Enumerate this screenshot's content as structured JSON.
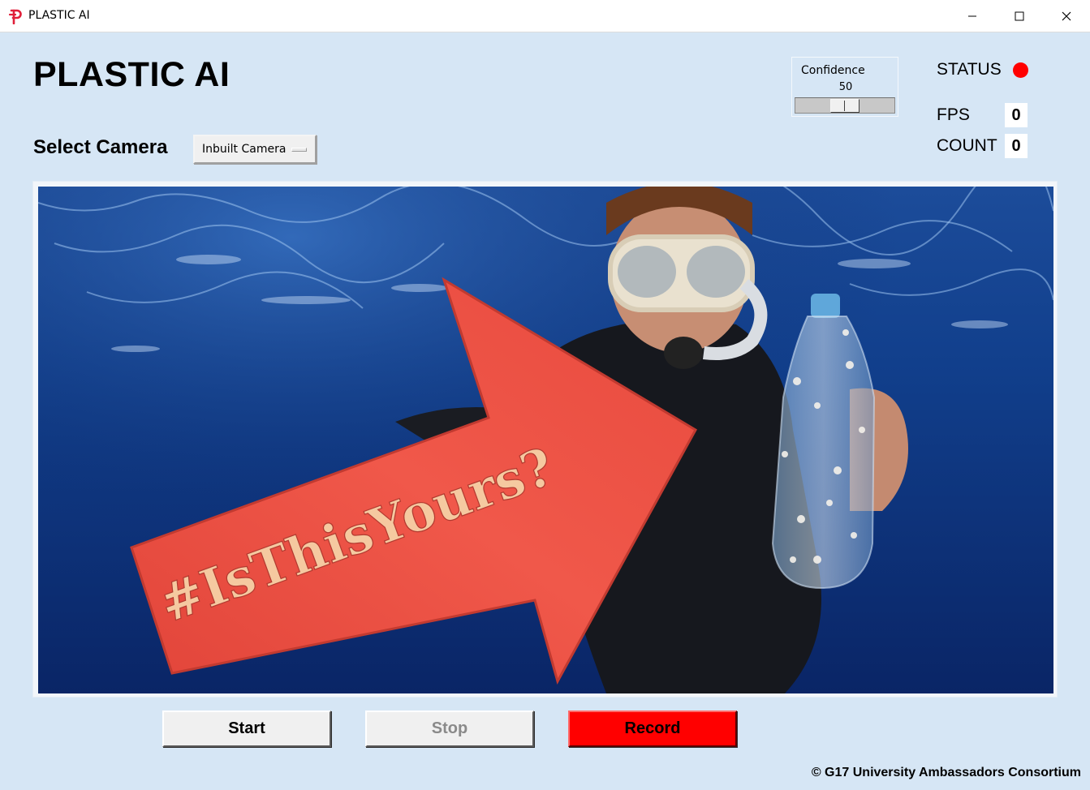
{
  "window": {
    "title": "PLASTIC AI",
    "icon": "plastic-ai-logo-icon",
    "controls": [
      "minimize-icon",
      "maximize-icon",
      "close-icon"
    ]
  },
  "header": {
    "app_title": "PLASTIC AI",
    "select_camera_label": "Select Camera",
    "camera_selected": "Inbuilt Camera"
  },
  "confidence": {
    "label": "Confidence",
    "value": "50",
    "fraction": 0.5
  },
  "status": {
    "status_label": "STATUS",
    "status_color": "#ff0000",
    "fps_label": "FPS",
    "fps_value": "0",
    "count_label": "COUNT",
    "count_value": "0"
  },
  "video": {
    "sign_text": "#IsThisYours?"
  },
  "buttons": {
    "start": "Start",
    "stop": "Stop",
    "record": "Record",
    "record_color": "#ff0000"
  },
  "footer": {
    "copyright": "© G17 University Ambassadors Consortium"
  }
}
